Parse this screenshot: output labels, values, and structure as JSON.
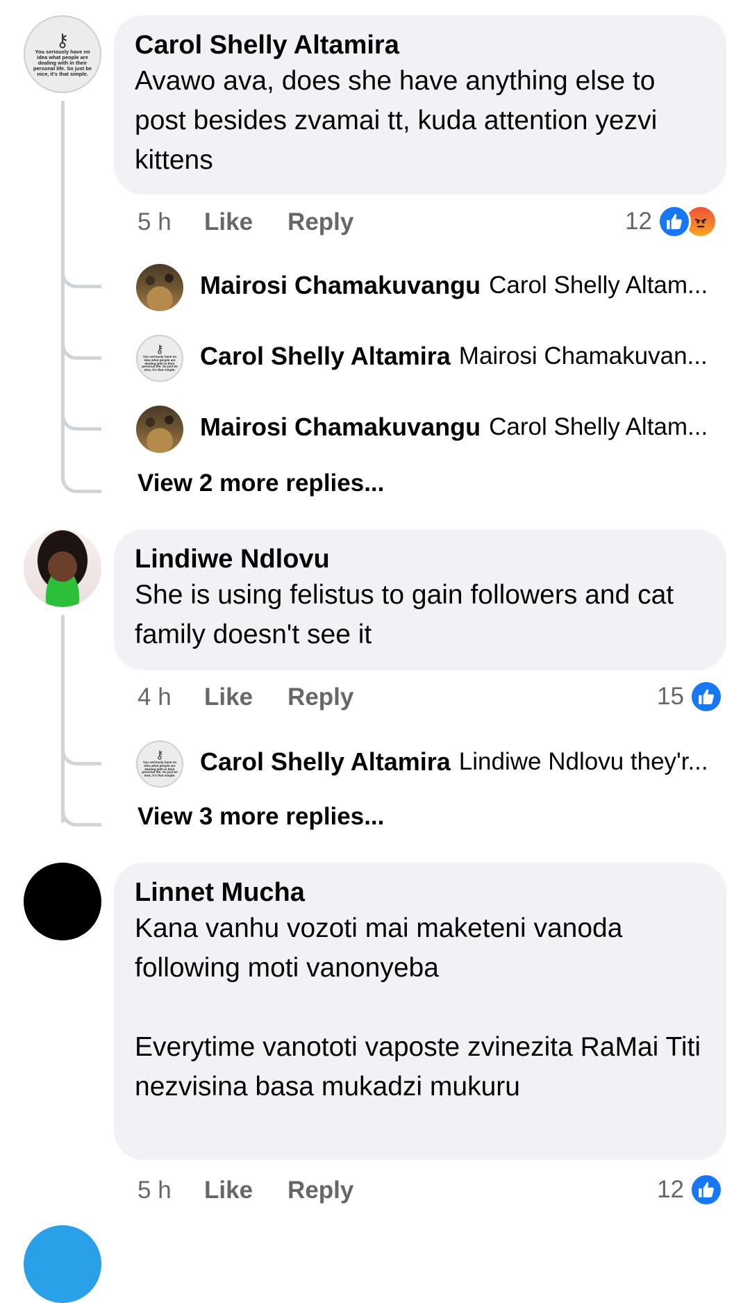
{
  "comments": [
    {
      "author": "Carol Shelly Altamira",
      "text": "Avawo ava, does she have anything else to post besides zvamai tt, kuda attention yezvi kittens",
      "time": "5 h",
      "like_label": "Like",
      "reply_label": "Reply",
      "reaction_count": "12",
      "reactions": [
        "like-icon",
        "angry-icon"
      ],
      "avatar_quote": "You seriously have no idea what people are dealing with in their personal life. So just be nice, it's that simple.",
      "replies": [
        {
          "author": "Mairosi Chamakuvangu",
          "snippet": "Carol Shelly Altam..."
        },
        {
          "author": "Carol Shelly Altamira",
          "snippet": "Mairosi Chamakuvan..."
        },
        {
          "author": "Mairosi Chamakuvangu",
          "snippet": "Carol Shelly Altam..."
        }
      ],
      "view_more": "View 2 more replies..."
    },
    {
      "author": "Lindiwe Ndlovu",
      "text": "She is using felistus to gain followers and cat family doesn't see it",
      "time": "4 h",
      "like_label": "Like",
      "reply_label": "Reply",
      "reaction_count": "15",
      "reactions": [
        "like-icon"
      ],
      "replies": [
        {
          "author": "Carol Shelly Altamira",
          "snippet": "Lindiwe Ndlovu they'r..."
        }
      ],
      "view_more": "View 3 more replies..."
    },
    {
      "author": "Linnet Mucha",
      "text": "Kana vanhu vozoti mai maketeni vanoda following moti vanonyeba\n\nEverytime vanototi vaposte zvinezita RaMai Titi nezvisina basa mukadzi mukuru",
      "time": "5 h",
      "like_label": "Like",
      "reply_label": "Reply",
      "reaction_count": "12",
      "reactions": [
        "like-icon"
      ]
    }
  ],
  "colors": {
    "bubble": "#f0f2f5",
    "meta_text": "#65676b",
    "like_blue": "#1877f2",
    "thread_line": "#d0d3d8"
  }
}
